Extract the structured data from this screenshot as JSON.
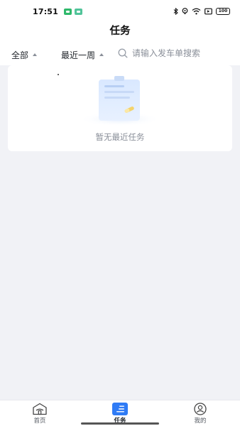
{
  "status_bar": {
    "time": "17:51",
    "battery": "100",
    "icons": [
      "bluetooth-icon",
      "location-icon",
      "wifi-icon",
      "cast-icon",
      "battery-icon"
    ]
  },
  "header": {
    "title": "任务"
  },
  "filters": {
    "status_label": "全部",
    "range_label": "最近一周",
    "search_placeholder": "请输入发车单搜索"
  },
  "empty_state": {
    "text": "暂无最近任务"
  },
  "tabbar": {
    "items": [
      {
        "label": "首页",
        "icon": "home-icon",
        "active": false
      },
      {
        "label": "任务",
        "icon": "task-list-icon",
        "active": true
      },
      {
        "label": "我的",
        "icon": "profile-icon",
        "active": false
      }
    ]
  },
  "colors": {
    "accent": "#2F7BF5",
    "page_background": "#F1F2F6",
    "muted_text": "#8A8F99"
  }
}
